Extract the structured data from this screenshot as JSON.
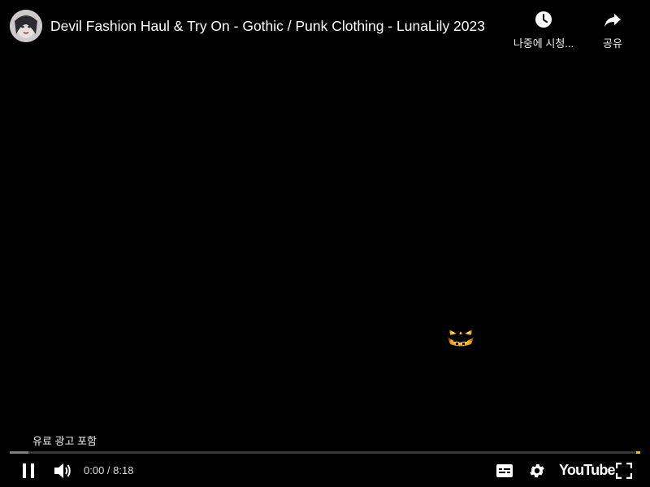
{
  "header": {
    "title": "Devil Fashion Haul & Try On - Gothic / Punk Clothing - LunaLily 2023",
    "watch_later_label": "나중에 시청...",
    "share_label": "공유"
  },
  "overlay": {
    "paid_promotion": "유료 광고 포함"
  },
  "player": {
    "current_time": "0:00",
    "separator": " / ",
    "duration": "8:18",
    "logo_text": "YouTube",
    "played_fraction": 0.0,
    "loaded_fraction": 0.03
  },
  "icons": {
    "play_pause": "pause-icon",
    "volume": "volume-icon",
    "subtitles": "subtitles-icon",
    "settings": "gear-icon",
    "fullscreen": "fullscreen-icon",
    "watch_later": "clock-icon",
    "share": "share-icon"
  },
  "colors": {
    "progress_played": "#ff0000",
    "ad_marker": "#f2c200"
  }
}
